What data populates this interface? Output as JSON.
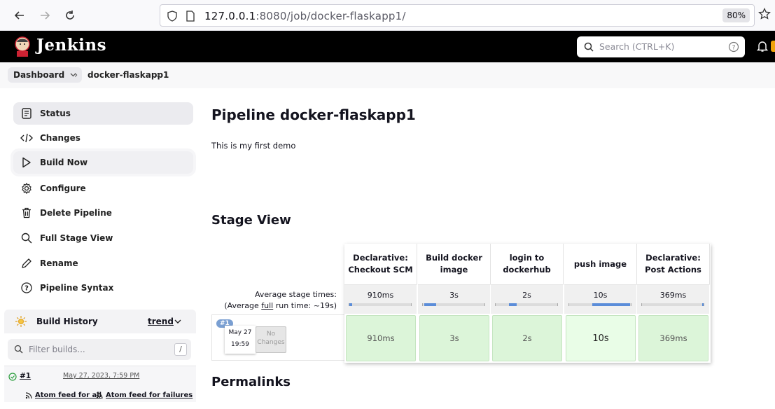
{
  "browser": {
    "url_host": "127.0.0.1",
    "url_rest": ":8080/job/docker-flaskapp1/",
    "zoom": "80%"
  },
  "header": {
    "title": "Jenkins",
    "search_placeholder": "Search (CTRL+K)"
  },
  "breadcrumb": {
    "dashboard": "Dashboard",
    "job": "docker-flaskapp1"
  },
  "sidebar": {
    "items": [
      {
        "label": "Status",
        "icon": "status-icon"
      },
      {
        "label": "Changes",
        "icon": "code-icon"
      },
      {
        "label": "Build Now",
        "icon": "play-icon"
      },
      {
        "label": "Configure",
        "icon": "gear-icon"
      },
      {
        "label": "Delete Pipeline",
        "icon": "trash-icon"
      },
      {
        "label": "Full Stage View",
        "icon": "search-icon"
      },
      {
        "label": "Rename",
        "icon": "pencil-icon"
      },
      {
        "label": "Pipeline Syntax",
        "icon": "help-icon"
      }
    ],
    "build_history": {
      "title": "Build History",
      "trend": "trend",
      "filter_placeholder": "Filter builds...",
      "filter_key": "/",
      "runs": [
        {
          "id": "#1",
          "date": "May 27, 2023, 7:59 PM"
        }
      ],
      "feed_all": "Atom feed for all",
      "feed_failures": "Atom feed for failures"
    }
  },
  "main": {
    "title": "Pipeline docker-flaskapp1",
    "description": "This is my first demo",
    "stage_view_title": "Stage View",
    "permalinks_title": "Permalinks",
    "avg_label_line1": "Average stage times:",
    "avg_label_line2_pre": "(Average ",
    "avg_label_full": "full",
    "avg_label_line2_post": " run time: ~19s)",
    "stages": [
      {
        "name": "Declarative: Checkout SCM",
        "avg": "910ms",
        "bar_fraction": 0.05,
        "run": "910ms"
      },
      {
        "name": "Build docker image",
        "avg": "3s",
        "bar_fraction": 0.2,
        "run": "3s"
      },
      {
        "name": "login to dockerhub",
        "avg": "2s",
        "bar_fraction": 0.12,
        "run": "2s"
      },
      {
        "name": "push image",
        "avg": "10s",
        "bar_fraction": 0.62,
        "run": "10s"
      },
      {
        "name": "Declarative: Post Actions",
        "avg": "369ms",
        "bar_fraction": 0.02,
        "run": "369ms"
      }
    ],
    "run": {
      "badge": "#1",
      "date": "May 27",
      "time": "19:59",
      "changes": "No Changes"
    }
  }
}
